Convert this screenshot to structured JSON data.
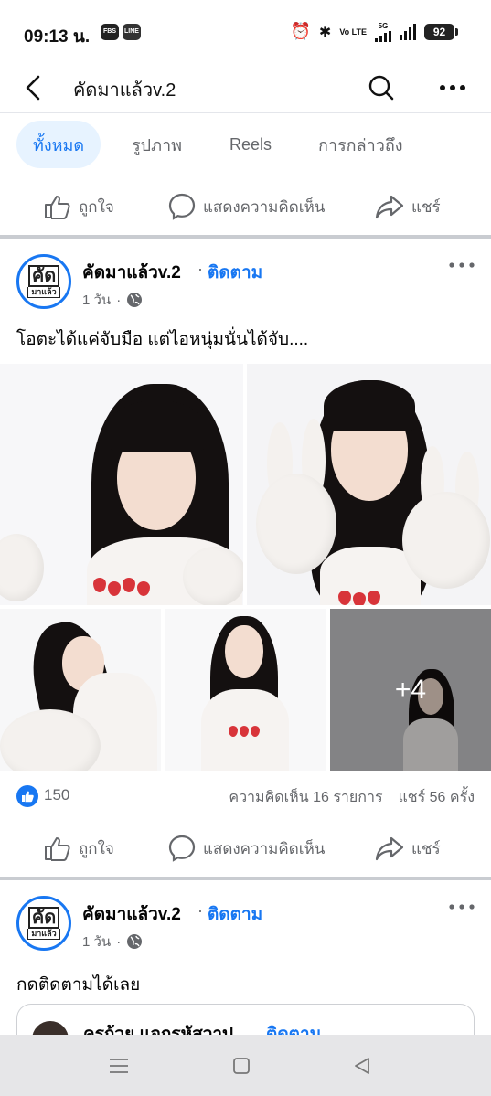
{
  "status_bar": {
    "time": "09:13 น.",
    "app_icons": [
      "FBS",
      "LINE"
    ],
    "network_label": "Vo LTE",
    "network_5g": "5G",
    "battery": "92"
  },
  "header": {
    "title": "คัดมาแล้วv.2"
  },
  "tabs": [
    {
      "label": "ทั้งหมด",
      "active": true
    },
    {
      "label": "รูปภาพ",
      "active": false
    },
    {
      "label": "Reels",
      "active": false
    },
    {
      "label": "การกล่าวถึง",
      "active": false
    }
  ],
  "actions": {
    "like": "ถูกใจ",
    "comment": "แสดงความคิดเห็น",
    "share": "แชร์"
  },
  "posts": [
    {
      "author": "คัดมาแล้วv.2",
      "separator": "·",
      "follow": "ติดตาม",
      "time": "1 วัน",
      "text": "โอตะได้แค่จับมือ แต่ไอหนุ่มนั่นได้จับ....",
      "more_photos": "+4",
      "likes": "150",
      "comments": "ความคิดเห็น 16 รายการ",
      "shares": "แชร์ 56 ครั้ง"
    },
    {
      "author": "คัดมาแล้วv.2",
      "separator": "·",
      "follow": "ติดตาม",
      "time": "1 วัน",
      "text": "กดติดตามได้เลย",
      "shared_author": "ครูก้วย แจกรหัสวาป",
      "shared_follow": "ติดตาม"
    }
  ],
  "avatar_text": {
    "line1": "คัด",
    "line2": "มาแล้ว"
  },
  "colors": {
    "accent": "#1877f2",
    "tab_active_bg": "#e7f3ff",
    "secondary_text": "#65676b",
    "divider": "#c9ccd1"
  },
  "icons": [
    "back-arrow-icon",
    "search-icon",
    "more-dots-icon",
    "thumbs-up-icon",
    "comment-bubble-icon",
    "share-arrow-icon",
    "globe-icon",
    "alarm-icon",
    "bluetooth-icon"
  ]
}
